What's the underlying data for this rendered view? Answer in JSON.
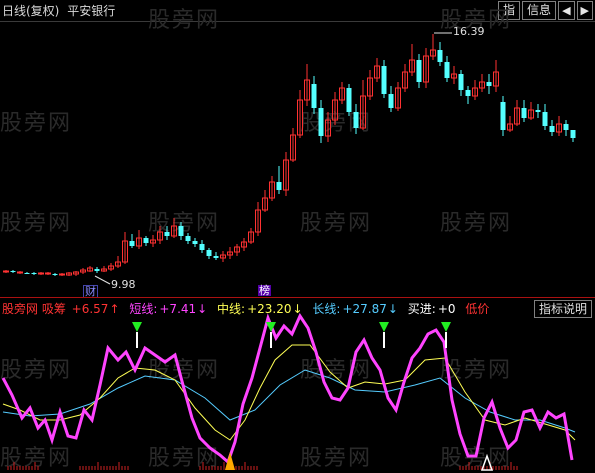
{
  "header": {
    "period_label": "日线(复权)",
    "stock_name": "平安银行"
  },
  "toolbar": {
    "indicator_label": "指",
    "info_label": "信息",
    "prev_label": "◀",
    "next_label": "▶"
  },
  "watermark": "股旁网",
  "price_chart": {
    "high_label": "16.39",
    "low_label": "9.98",
    "badge_cai": "财",
    "badge_bang": "榜",
    "up_color": "#ff3232",
    "down_color": "#54ffff"
  },
  "indicator": {
    "name": "股旁网 吸筹",
    "name_value": "+6.57",
    "short_label": "短线:",
    "short_value": "+7.41",
    "mid_label": "中线:",
    "mid_value": "+23.20",
    "long_label": "长线:",
    "long_value": "+27.87",
    "buy_label": "买进:",
    "buy_value": "+0",
    "low_label": "低价",
    "explain_button": "指标说明",
    "colors": {
      "name": "#ff3333",
      "short": "#ff44ff",
      "mid": "#ffff55",
      "long": "#55ccff",
      "buy": "#ffffff",
      "low": "#ff3333"
    }
  }
}
